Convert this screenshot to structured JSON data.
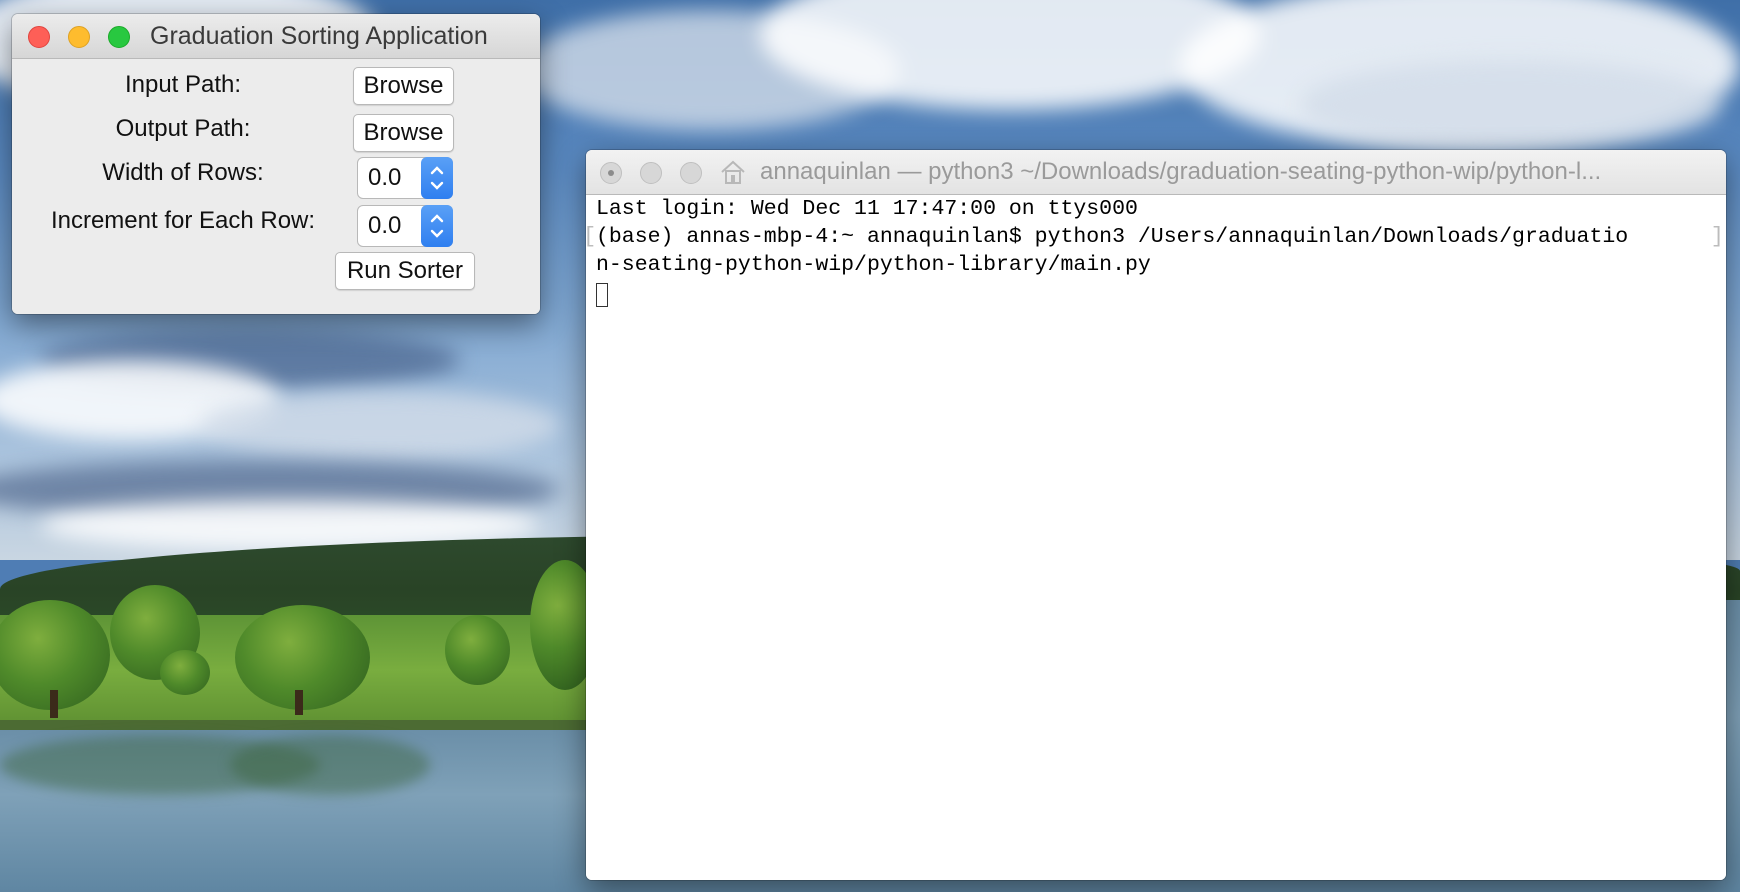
{
  "graduation_app": {
    "title": "Graduation Sorting Application",
    "input_path_label": "Input Path:",
    "output_path_label": "Output Path:",
    "width_label": "Width of Rows:",
    "increment_label": "Increment for Each Row:",
    "browse_label": "Browse",
    "width_value": "0.0",
    "increment_value": "0.0",
    "run_label": "Run Sorter"
  },
  "terminal": {
    "title": "annaquinlan — python3 ~/Downloads/graduation-seating-python-wip/python-l...",
    "home_icon": "home-icon",
    "lines": [
      "Last login: Wed Dec 11 17:47:00 on ttys000",
      "(base) annas-mbp-4:~ annaquinlan$ python3 /Users/annaquinlan/Downloads/graduatio",
      "n-seating-python-wip/python-library/main.py"
    ],
    "wrap_mark_left": "[",
    "wrap_mark_right": "]"
  },
  "colors": {
    "accent_blue": "#2f7ff0",
    "close_red": "#fe5f57",
    "minimize_yellow": "#febc2e",
    "zoom_green": "#28c840"
  }
}
